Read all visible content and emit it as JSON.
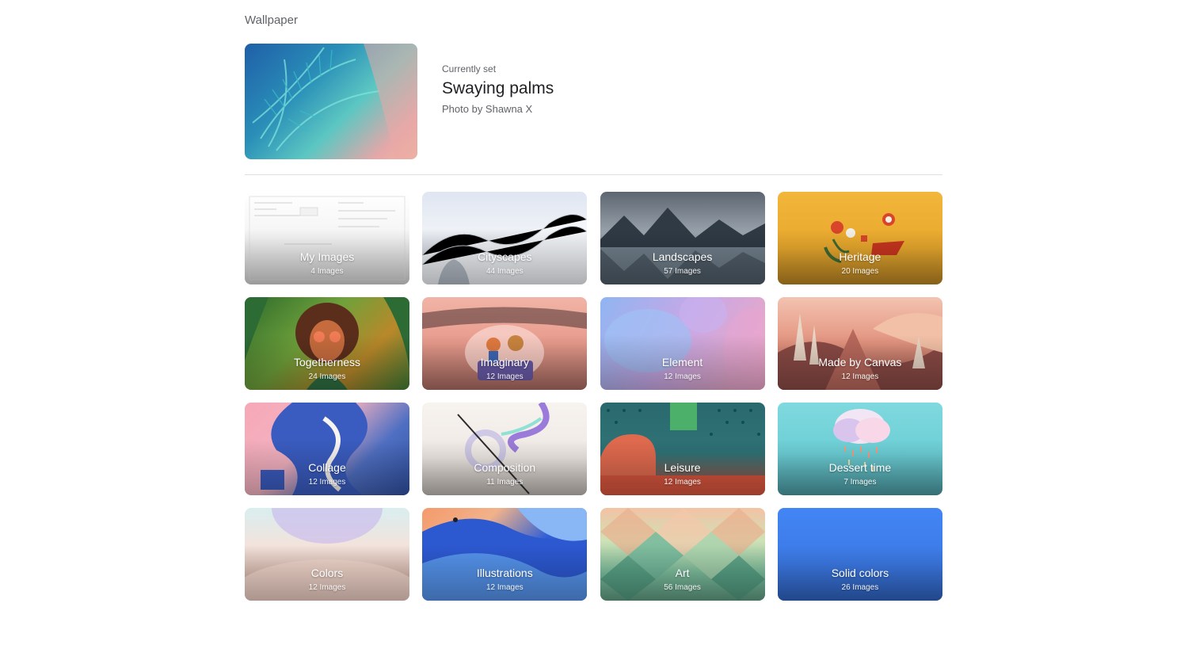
{
  "page": {
    "title": "Wallpaper"
  },
  "current": {
    "label": "Currently set",
    "name": "Swaying palms",
    "credit": "Photo by Shawna X"
  },
  "collections": [
    {
      "name": "My Images",
      "count": "4 Images",
      "style": "bg-myimages"
    },
    {
      "name": "Cityscapes",
      "count": "44 Images",
      "style": "bg-cityscapes"
    },
    {
      "name": "Landscapes",
      "count": "57 Images",
      "style": "bg-landscapes"
    },
    {
      "name": "Heritage",
      "count": "20 Images",
      "style": "bg-heritage"
    },
    {
      "name": "Togetherness",
      "count": "24 Images",
      "style": "bg-together"
    },
    {
      "name": "Imaginary",
      "count": "12 Images",
      "style": "bg-imaginary"
    },
    {
      "name": "Element",
      "count": "12 Images",
      "style": "bg-element"
    },
    {
      "name": "Made by Canvas",
      "count": "12 Images",
      "style": "bg-canvas"
    },
    {
      "name": "Collage",
      "count": "12 Images",
      "style": "bg-collage"
    },
    {
      "name": "Composition",
      "count": "11 Images",
      "style": "bg-composition"
    },
    {
      "name": "Leisure",
      "count": "12 Images",
      "style": "bg-leisure"
    },
    {
      "name": "Dessert time",
      "count": "7 Images",
      "style": "bg-dessert"
    },
    {
      "name": "Colors",
      "count": "12 Images",
      "style": "bg-colors"
    },
    {
      "name": "Illustrations",
      "count": "12 Images",
      "style": "bg-illus"
    },
    {
      "name": "Art",
      "count": "56 Images",
      "style": "bg-art"
    },
    {
      "name": "Solid colors",
      "count": "26 Images",
      "style": "bg-solid"
    }
  ]
}
